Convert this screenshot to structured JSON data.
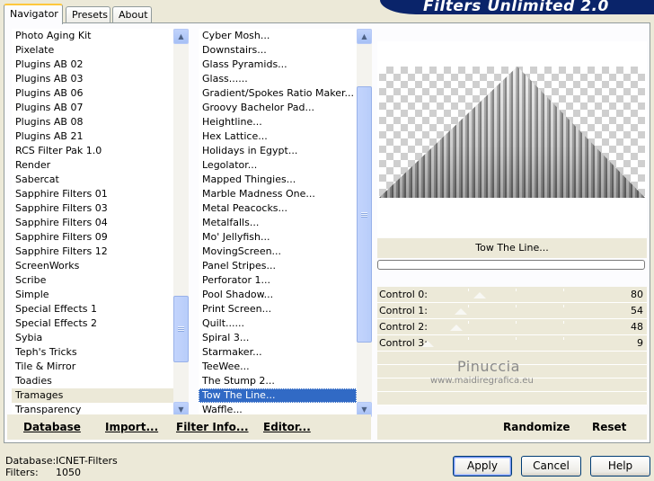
{
  "banner_title": "Filters Unlimited 2.0",
  "tabs": [
    {
      "label": "Navigator",
      "active": true
    },
    {
      "label": "Presets",
      "active": false
    },
    {
      "label": "About",
      "active": false
    }
  ],
  "categories": {
    "items": [
      "Photo Aging Kit",
      "Pixelate",
      "Plugins AB 02",
      "Plugins AB 03",
      "Plugins AB 06",
      "Plugins AB 07",
      "Plugins AB 08",
      "Plugins AB 21",
      "RCS Filter Pak 1.0",
      "Render",
      "Sabercat",
      "Sapphire Filters 01",
      "Sapphire Filters 03",
      "Sapphire Filters 04",
      "Sapphire Filters 09",
      "Sapphire Filters 12",
      "ScreenWorks",
      "Scribe",
      "Simple",
      "Special Effects 1",
      "Special Effects 2",
      "Sybia",
      "Teph's Tricks",
      "Tile & Mirror",
      "Toadies",
      "Tramages",
      "Transparency"
    ],
    "selected": "Tramages"
  },
  "filters": {
    "items": [
      "Cyber Mosh...",
      "Downstairs...",
      "Glass Pyramids...",
      "Glass......",
      "Gradient/Spokes Ratio Maker...",
      "Groovy Bachelor Pad...",
      "Heightline...",
      "Hex Lattice...",
      "Holidays in Egypt...",
      "Legolator...",
      "Mapped Thingies...",
      "Marble Madness One...",
      "Metal Peacocks...",
      "Metalfalls...",
      "Mo' Jellyfish...",
      "MovingScreen...",
      "Panel Stripes...",
      "Perforator 1...",
      "Pool Shadow...",
      "Print Screen...",
      "Quilt......",
      "Spiral 3...",
      "Starmaker...",
      "TeeWee...",
      "The Stump 2...",
      "Tow The Line...",
      "Waffle..."
    ],
    "selected": "Tow The Line..."
  },
  "selected_filter_name": "Tow The Line...",
  "controls": [
    {
      "label": "Control 0:",
      "value": "80"
    },
    {
      "label": "Control 1:",
      "value": "54"
    },
    {
      "label": "Control 2:",
      "value": "48"
    },
    {
      "label": "Control 3:",
      "value": "9"
    }
  ],
  "watermark": {
    "name": "Pinuccia",
    "url": "www.maidiregrafica.eu"
  },
  "left_actions": {
    "database": "Database",
    "import": "Import...",
    "filter_info": "Filter Info...",
    "editor": "Editor..."
  },
  "right_actions": {
    "randomize": "Randomize",
    "reset": "Reset"
  },
  "footer": {
    "database_label": "Database:",
    "database_value": "ICNET-Filters",
    "filters_label": "Filters:",
    "filters_value": "1050"
  },
  "buttons": {
    "apply": "Apply",
    "cancel": "Cancel",
    "help": "Help"
  }
}
